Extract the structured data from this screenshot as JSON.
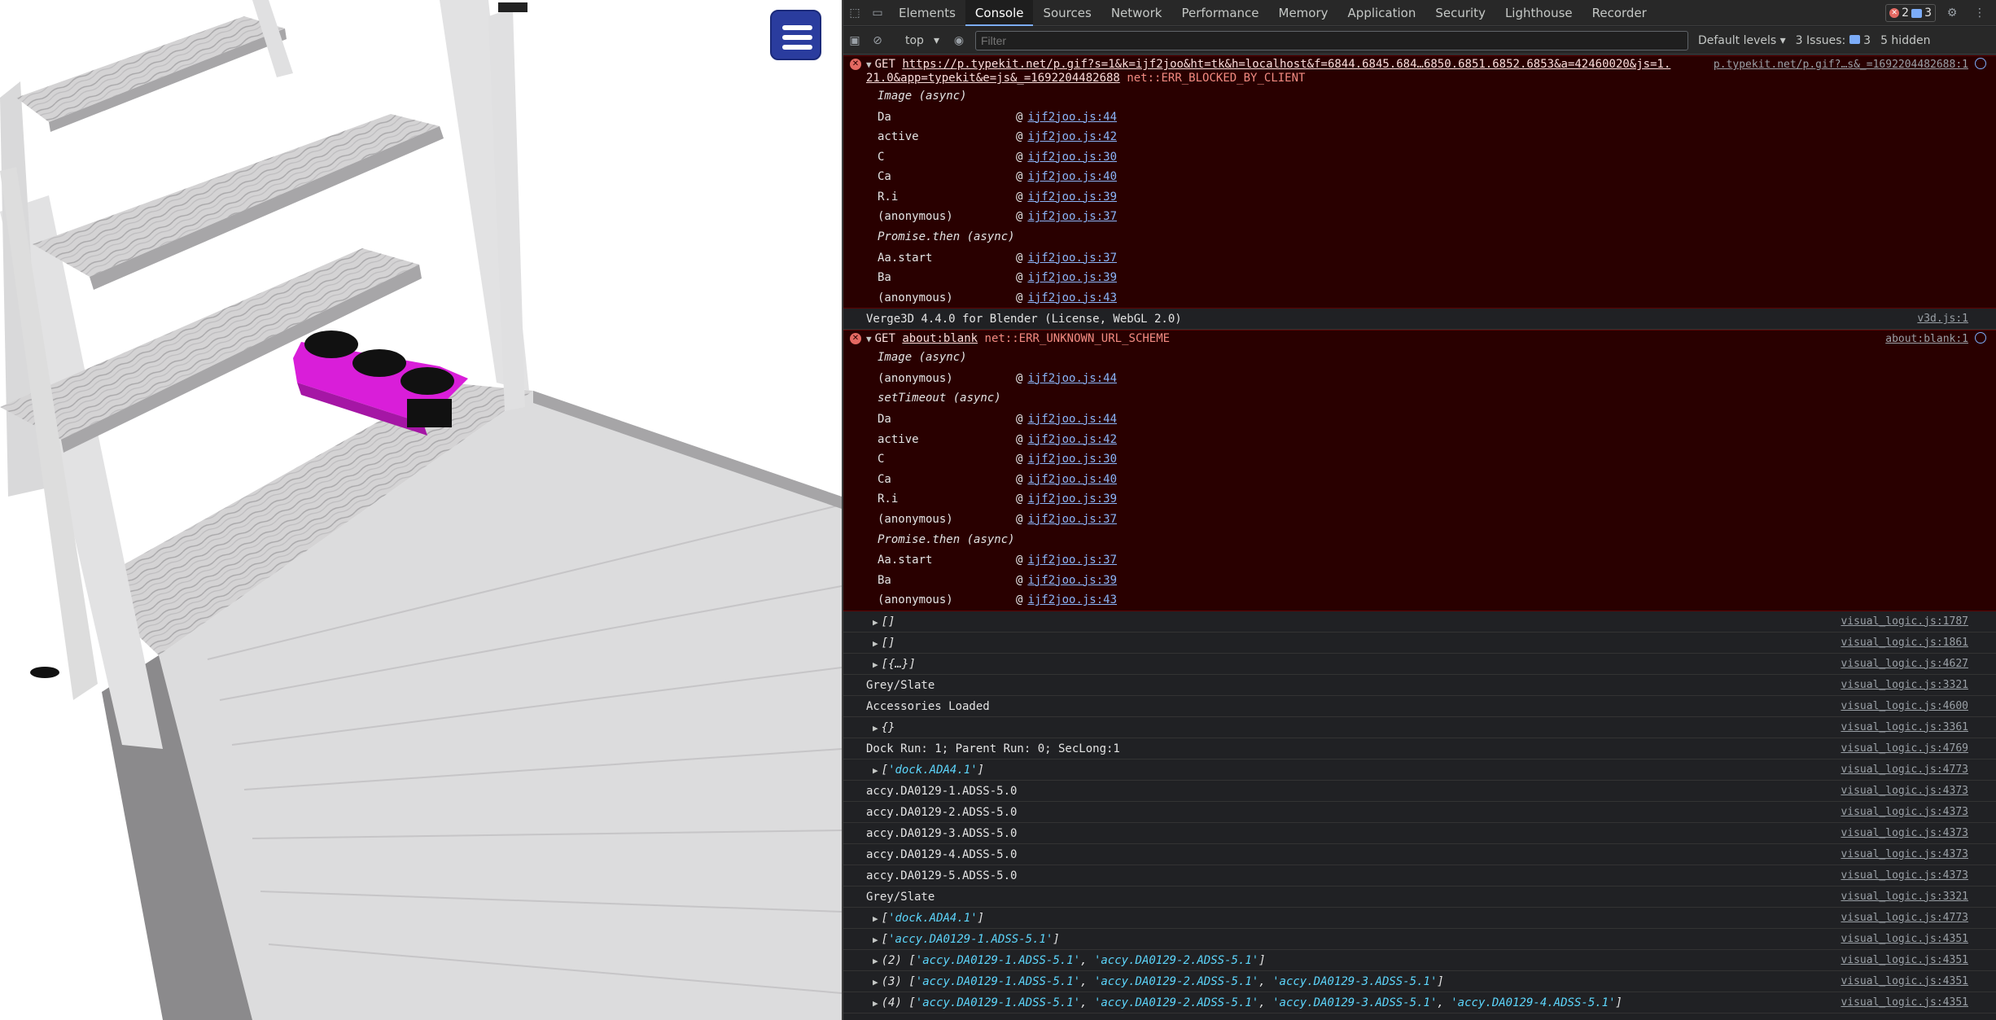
{
  "scene": {
    "menu_button_label": "Menu"
  },
  "devtools": {
    "tabs": [
      "Elements",
      "Console",
      "Sources",
      "Network",
      "Performance",
      "Memory",
      "Application",
      "Security",
      "Lighthouse",
      "Recorder"
    ],
    "active_tab": "Console",
    "error_count": "2",
    "message_count": "3",
    "context": "top",
    "filter_placeholder": "Filter",
    "default_levels": "Default levels",
    "issues_label": "3 Issues:",
    "issues_count": "3",
    "hidden_label": "5 hidden",
    "error1": {
      "method": "GET",
      "url_line1": "https://p.typekit.net/p.gif?s=1&k=ijf2joo&ht=tk&h=localhost&f=6844.6845.684…6850.6851.6852.6853&a=42460020&js=1.",
      "url_line2": "21.0&app=typekit&e=js&_=1692204482688",
      "error": "net::ERR_BLOCKED_BY_CLIENT",
      "source": "p.typekit.net/p.gif?…s&_=1692204482688:1",
      "trace": [
        {
          "async": "Image (async)"
        },
        {
          "fn": "Da",
          "file": "ijf2joo.js:44"
        },
        {
          "fn": "active",
          "file": "ijf2joo.js:42"
        },
        {
          "fn": "C",
          "file": "ijf2joo.js:30"
        },
        {
          "fn": "Ca",
          "file": "ijf2joo.js:40"
        },
        {
          "fn": "R.i",
          "file": "ijf2joo.js:39"
        },
        {
          "fn": "(anonymous)",
          "file": "ijf2joo.js:37"
        },
        {
          "async": "Promise.then (async)"
        },
        {
          "fn": "Aa.start",
          "file": "ijf2joo.js:37"
        },
        {
          "fn": "Ba",
          "file": "ijf2joo.js:39"
        },
        {
          "fn": "(anonymous)",
          "file": "ijf2joo.js:43"
        }
      ]
    },
    "verge_msg": {
      "text": "Verge3D 4.4.0 for Blender (License, WebGL 2.0)",
      "source": "v3d.js:1"
    },
    "error2": {
      "method": "GET",
      "url": "about:blank",
      "error": "net::ERR_UNKNOWN_URL_SCHEME",
      "source": "about:blank:1",
      "trace": [
        {
          "async": "Image (async)"
        },
        {
          "fn": "(anonymous)",
          "file": "ijf2joo.js:44"
        },
        {
          "async": "setTimeout (async)"
        },
        {
          "fn": "Da",
          "file": "ijf2joo.js:44"
        },
        {
          "fn": "active",
          "file": "ijf2joo.js:42"
        },
        {
          "fn": "C",
          "file": "ijf2joo.js:30"
        },
        {
          "fn": "Ca",
          "file": "ijf2joo.js:40"
        },
        {
          "fn": "R.i",
          "file": "ijf2joo.js:39"
        },
        {
          "fn": "(anonymous)",
          "file": "ijf2joo.js:37"
        },
        {
          "async": "Promise.then (async)"
        },
        {
          "fn": "Aa.start",
          "file": "ijf2joo.js:37"
        },
        {
          "fn": "Ba",
          "file": "ijf2joo.js:39"
        },
        {
          "fn": "(anonymous)",
          "file": "ijf2joo.js:43"
        }
      ]
    },
    "logs": [
      {
        "expand": true,
        "prefix": "",
        "text": "[]",
        "italic": true,
        "source": "visual_logic.js:1787"
      },
      {
        "expand": true,
        "prefix": "",
        "text": "[]",
        "italic": true,
        "source": "visual_logic.js:1861"
      },
      {
        "expand": true,
        "prefix": "",
        "text": "[{…}]",
        "italic": true,
        "source": "visual_logic.js:4627"
      },
      {
        "expand": false,
        "prefix": "",
        "text": "Grey/Slate",
        "source": "visual_logic.js:3321"
      },
      {
        "expand": false,
        "prefix": "",
        "text": "Accessories Loaded",
        "source": "visual_logic.js:4600"
      },
      {
        "expand": true,
        "prefix": "",
        "text": "{}",
        "italic": true,
        "source": "visual_logic.js:3361"
      },
      {
        "expand": false,
        "prefix": "",
        "text": "Dock Run: 1; Parent Run: 0; SecLong:1",
        "source": "visual_logic.js:4769"
      },
      {
        "expand": true,
        "prefix": "",
        "strs": [
          "'dock.ADA4.1'"
        ],
        "source": "visual_logic.js:4773"
      },
      {
        "expand": false,
        "prefix": "",
        "text": "accy.DA0129-1.ADSS-5.0",
        "source": "visual_logic.js:4373"
      },
      {
        "expand": false,
        "prefix": "",
        "text": "accy.DA0129-2.ADSS-5.0",
        "source": "visual_logic.js:4373"
      },
      {
        "expand": false,
        "prefix": "",
        "text": "accy.DA0129-3.ADSS-5.0",
        "source": "visual_logic.js:4373"
      },
      {
        "expand": false,
        "prefix": "",
        "text": "accy.DA0129-4.ADSS-5.0",
        "source": "visual_logic.js:4373"
      },
      {
        "expand": false,
        "prefix": "",
        "text": "accy.DA0129-5.ADSS-5.0",
        "source": "visual_logic.js:4373"
      },
      {
        "expand": false,
        "prefix": "",
        "text": "Grey/Slate",
        "source": "visual_logic.js:3321"
      },
      {
        "expand": true,
        "prefix": "",
        "strs": [
          "'dock.ADA4.1'"
        ],
        "source": "visual_logic.js:4773"
      },
      {
        "expand": true,
        "prefix": "",
        "strs": [
          "'accy.DA0129-1.ADSS-5.1'"
        ],
        "source": "visual_logic.js:4351"
      },
      {
        "expand": true,
        "prefix": "(2) ",
        "strs": [
          "'accy.DA0129-1.ADSS-5.1'",
          "'accy.DA0129-2.ADSS-5.1'"
        ],
        "source": "visual_logic.js:4351"
      },
      {
        "expand": true,
        "prefix": "(3) ",
        "strs": [
          "'accy.DA0129-1.ADSS-5.1'",
          "'accy.DA0129-2.ADSS-5.1'",
          "'accy.DA0129-3.ADSS-5.1'"
        ],
        "source": "visual_logic.js:4351"
      },
      {
        "expand": true,
        "prefix": "(4) ",
        "strs": [
          "'accy.DA0129-1.ADSS-5.1'",
          "'accy.DA0129-2.ADSS-5.1'",
          "'accy.DA0129-3.ADSS-5.1'",
          "'accy.DA0129-4.ADSS-5.1'"
        ],
        "source": "visual_logic.js:4351"
      }
    ]
  }
}
